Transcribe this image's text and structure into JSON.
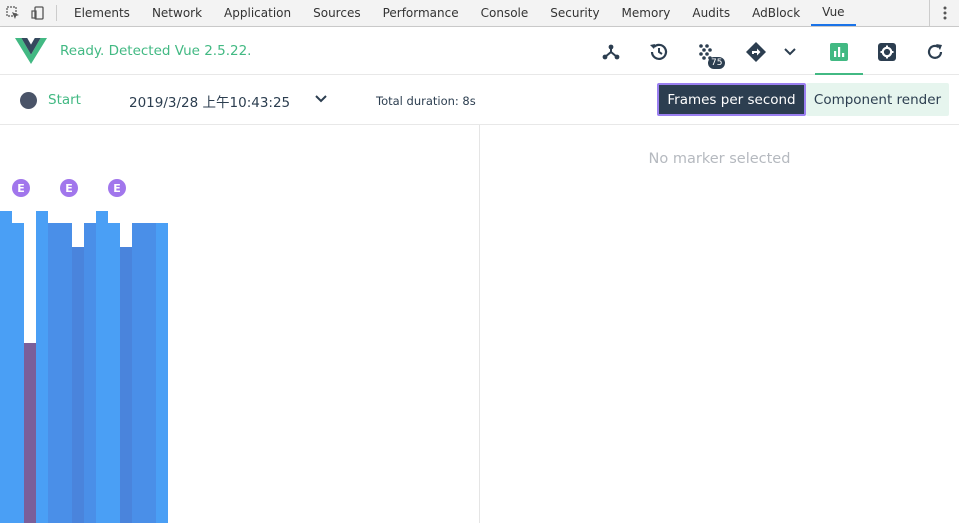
{
  "devtools": {
    "tabs": [
      {
        "label": "Elements",
        "active": false
      },
      {
        "label": "Network",
        "active": false
      },
      {
        "label": "Application",
        "active": false
      },
      {
        "label": "Sources",
        "active": false
      },
      {
        "label": "Performance",
        "active": false
      },
      {
        "label": "Console",
        "active": false
      },
      {
        "label": "Security",
        "active": false
      },
      {
        "label": "Memory",
        "active": false
      },
      {
        "label": "Audits",
        "active": false
      },
      {
        "label": "AdBlock",
        "active": false
      },
      {
        "label": "Vue",
        "active": true
      }
    ]
  },
  "vue": {
    "status": "Ready. Detected Vue 2.5.22.",
    "vuex_badge": "75",
    "accent": "#42b983"
  },
  "toolbar": {
    "start_label": "Start",
    "date": "2019/3/28 上午10:43:25",
    "duration": "Total duration: 8s",
    "fps_button": "Frames per second",
    "component_button": "Component render"
  },
  "right_pane": {
    "empty_message": "No marker selected"
  },
  "markers": [
    {
      "label": "E"
    },
    {
      "label": "E"
    },
    {
      "label": "E"
    }
  ],
  "chart_data": {
    "type": "bar",
    "note_series": "frames per second over time",
    "values": [
      57,
      55,
      30,
      57,
      55,
      55,
      51,
      55,
      57,
      55,
      51,
      55,
      55,
      55
    ],
    "colors": [
      "#4a9ff5",
      "#4a9ff5",
      "#7a5f9a",
      "#4a9ff5",
      "#4a8fe8",
      "#4a8fe8",
      "#4a84dc",
      "#4a8fe8",
      "#4a9ff5",
      "#4a9ff5",
      "#4a84dc",
      "#4a8fe8",
      "#4a8fe8",
      "#4a9ff5"
    ],
    "ylim": [
      0,
      60
    ]
  }
}
